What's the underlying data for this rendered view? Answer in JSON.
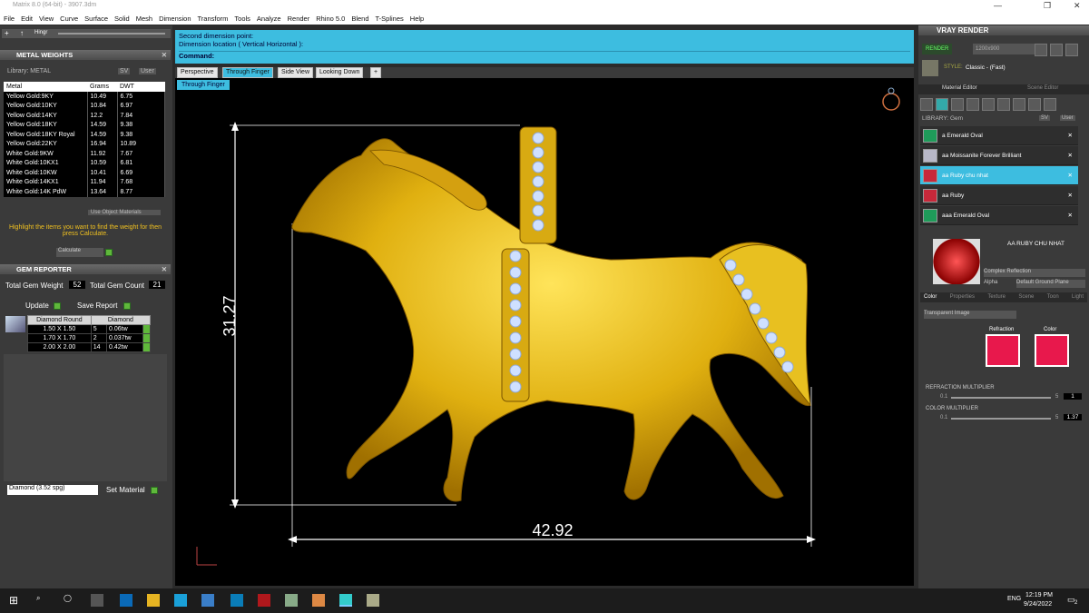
{
  "window": {
    "title": "Matrix 8.0 (64-bit) - 3907.3dm"
  },
  "menu": [
    "File",
    "Edit",
    "View",
    "Curve",
    "Surface",
    "Solid",
    "Mesh",
    "Dimension",
    "Transform",
    "Tools",
    "Analyze",
    "Render",
    "Rhino 5.0",
    "Blend",
    "T-Splines",
    "Help"
  ],
  "left": {
    "toolbar_label": "Hingr",
    "metal_weights": {
      "title": "METAL WEIGHTS",
      "library": "Library: METAL",
      "sv": "SV",
      "user": "User",
      "headers": [
        "Metal",
        "Grams",
        "DWT"
      ],
      "rows": [
        [
          "Yellow Gold:9KY",
          "10.49",
          "6.75"
        ],
        [
          "Yellow Gold:10KY",
          "10.84",
          "6.97"
        ],
        [
          "Yellow Gold:14KY",
          "12.2",
          "7.84"
        ],
        [
          "Yellow Gold:18KY",
          "14.59",
          "9.38"
        ],
        [
          "Yellow Gold:18KY Royal",
          "14.59",
          "9.38"
        ],
        [
          "Yellow Gold:22KY",
          "16.94",
          "10.89"
        ],
        [
          "White Gold:9KW",
          "11.92",
          "7.67"
        ],
        [
          "White Gold:10KX1",
          "10.59",
          "6.81"
        ],
        [
          "White Gold:10KW",
          "10.41",
          "6.69"
        ],
        [
          "White Gold:14KX1",
          "11.94",
          "7.68"
        ],
        [
          "White Gold:14K PdW",
          "13.64",
          "8.77"
        ]
      ],
      "use_object_materials": "Use Object Materials",
      "hint": "Highlight the items you want to find the weight for then press Calculate.",
      "calculate": "Calculate"
    },
    "gem_reporter": {
      "title": "GEM REPORTER",
      "total_weight_label": "Total Gem Weight",
      "total_weight": "52",
      "total_count_label": "Total Gem Count",
      "total_count": "21",
      "update": "Update",
      "save_report": "Save Report",
      "headers": [
        "Diamond Round",
        "Diamond"
      ],
      "rows": [
        [
          "1.50 X 1.50",
          "5",
          "0.06tw"
        ],
        [
          "1.70 X 1.70",
          "2",
          "0.037tw"
        ],
        [
          "2.00 X 2.00",
          "14",
          "0.42tw"
        ]
      ]
    },
    "material_select": "Diamond   (3.52 spg)",
    "set_material": "Set Material"
  },
  "command": {
    "line1": "Second dimension point:",
    "line2": "Dimension location ( Vertical  Horizontal ):",
    "prompt": "Command:"
  },
  "view_tabs": [
    "Perspective",
    "Through Finger",
    "Side View",
    "Looking Down"
  ],
  "active_view": "Through Finger",
  "dims": {
    "height": "31.27",
    "width": "42.92"
  },
  "vray": {
    "title": "VRAY RENDER",
    "render": "RENDER",
    "resolution": "1200x900",
    "style_label": "STYLE:",
    "style": "Classic - (Fast)",
    "tabs": [
      "Material Editor",
      "Scene Editor"
    ],
    "library": "LIBRARY: Gem",
    "sv": "SV",
    "user": "User",
    "items": [
      {
        "name": "a Emerald Oval",
        "color": "#1f9c5a"
      },
      {
        "name": "aa Moissanite Forever Brilliant",
        "color": "#b8b8c8"
      },
      {
        "name": "aa Ruby chu nhat",
        "color": "#c8283a"
      },
      {
        "name": "aa Ruby",
        "color": "#c8283a"
      },
      {
        "name": "aaa Emerald Oval",
        "color": "#1f9c5a"
      }
    ],
    "selected": "AA RUBY CHU NHAT",
    "complex": "Complex Reflection",
    "alpha": "Alpha",
    "ground": "Default Ground Plane",
    "subtabs": [
      "Color",
      "Properties",
      "Texture",
      "Scene",
      "Toon",
      "Light"
    ],
    "transparent": "Transparent Image",
    "refraction": "Refraction",
    "color": "Color",
    "refraction_multiplier": {
      "label": "REFRACTION MULTIPLIER",
      "min": "0.1",
      "max": "5",
      "value": "1"
    },
    "color_multiplier": {
      "label": "COLOR MULTIPLIER",
      "min": "0.1",
      "max": "5",
      "value": "1.37"
    }
  },
  "taskbar": {
    "time": "12:19 PM",
    "date": "9/24/2022",
    "lang": "ENG",
    "badge": "2"
  }
}
